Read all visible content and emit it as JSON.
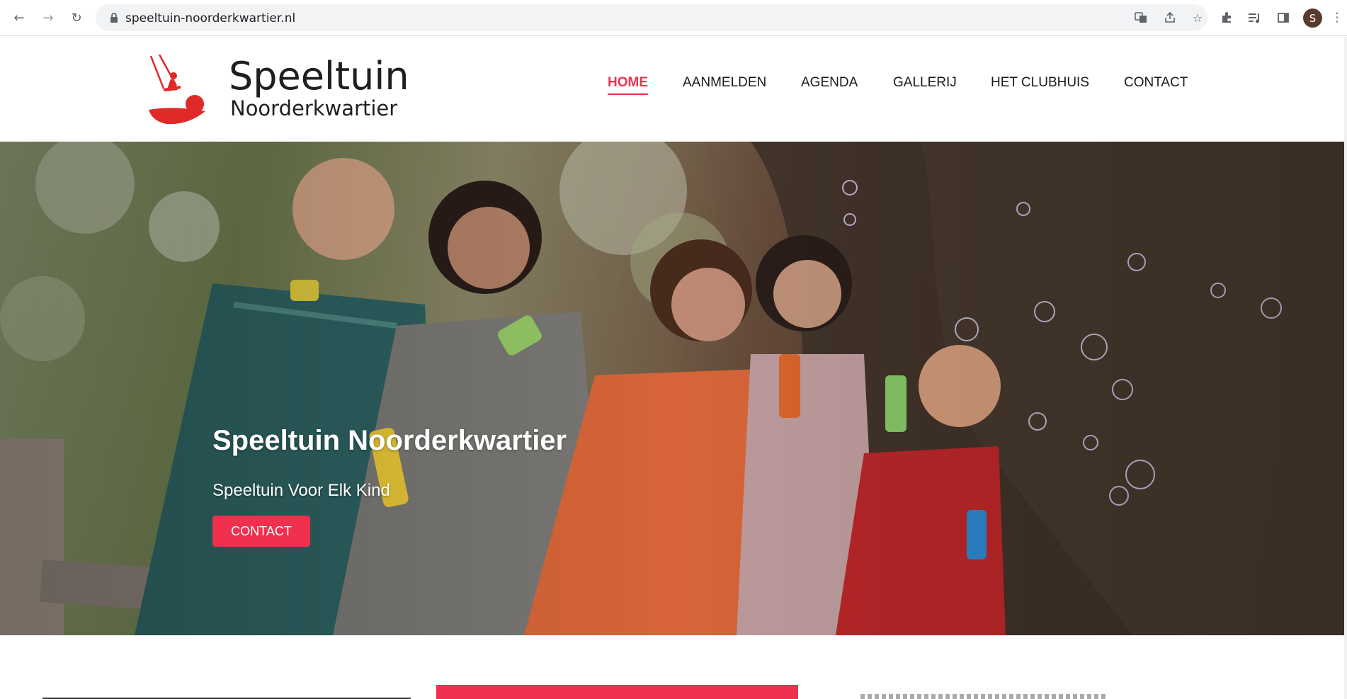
{
  "browser": {
    "url": "speeltuin-noorderkwartier.nl",
    "profile_initial": "S",
    "icons": [
      "back-arrow-icon",
      "forward-arrow-icon",
      "reload-icon",
      "lock-icon",
      "translate-icon",
      "share-icon",
      "star-icon",
      "extensions-icon",
      "media-icon",
      "side-panel-icon",
      "menu-icon"
    ]
  },
  "site": {
    "logo_title": "Speeltuin",
    "logo_subtitle": "Noorderkwartier",
    "nav": [
      {
        "label": "HOME",
        "active": true
      },
      {
        "label": "AANMELDEN",
        "active": false
      },
      {
        "label": "AGENDA",
        "active": false
      },
      {
        "label": "GALLERIJ",
        "active": false
      },
      {
        "label": "HET CLUBHUIS",
        "active": false
      },
      {
        "label": "CONTACT",
        "active": false
      }
    ],
    "accent_color": "#f0304f"
  },
  "hero": {
    "title": "Speeltuin Noorderkwartier",
    "subtitle": "Speeltuin Voor Elk Kind",
    "button_label": "CONTACT"
  }
}
